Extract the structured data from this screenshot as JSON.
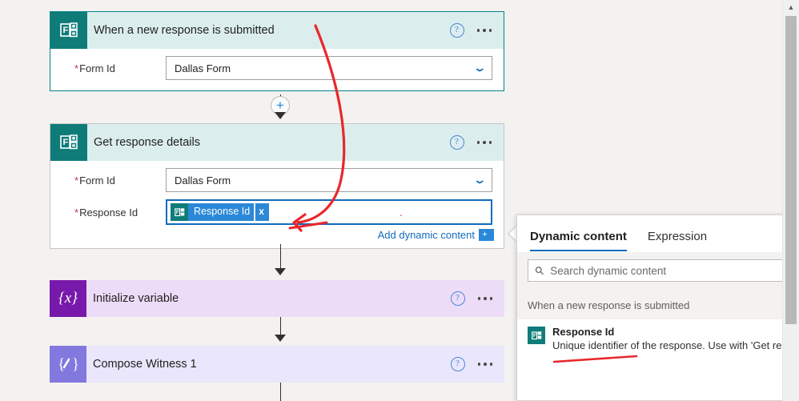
{
  "canvas": {
    "cards": [
      {
        "id": "trigger",
        "title": "When a new response is submitted",
        "icon": "microsoft-forms-icon",
        "fields": [
          {
            "label": "Form Id",
            "required": true,
            "value": "Dallas Form",
            "control": "dropdown"
          }
        ]
      },
      {
        "id": "get-response-details",
        "title": "Get response details",
        "icon": "microsoft-forms-icon",
        "fields": [
          {
            "label": "Form Id",
            "required": true,
            "value": "Dallas Form",
            "control": "dropdown"
          },
          {
            "label": "Response Id",
            "required": true,
            "value": "",
            "control": "token-input",
            "token": "Response Id",
            "token_remove": "x"
          }
        ],
        "add_dynamic_content": "Add dynamic content",
        "add_dynamic_content_button": "+"
      },
      {
        "id": "initialize-variable",
        "title": "Initialize variable",
        "icon": "variable-braces-icon",
        "icon_glyph": "{x}",
        "fields": []
      },
      {
        "id": "compose-witness-1",
        "title": "Compose Witness 1",
        "icon": "compose-icon",
        "icon_glyph": "{/}",
        "fields": []
      }
    ],
    "connector_plus": "+",
    "help_glyph": "?"
  },
  "dynamic_content_panel": {
    "tabs": [
      {
        "label": "Dynamic content",
        "active": true
      },
      {
        "label": "Expression",
        "active": false
      }
    ],
    "search": {
      "placeholder": "Search dynamic content",
      "value": ""
    },
    "group_label": "When a new response is submitted",
    "items": [
      {
        "title": "Response Id",
        "description": "Unique identifier of the response. Use with 'Get response",
        "icon": "microsoft-forms-icon"
      }
    ]
  },
  "scrollbar": {
    "up_arrow": "▲"
  },
  "colors": {
    "forms_teal": "#0f7c79",
    "trigger_header": "#dbeeed",
    "variable_purple": "#7719aa",
    "compose_violet": "#8378de",
    "accent_blue": "#0f6cbd",
    "annotation_red": "#e8272c",
    "required_red": "#c4314b"
  }
}
